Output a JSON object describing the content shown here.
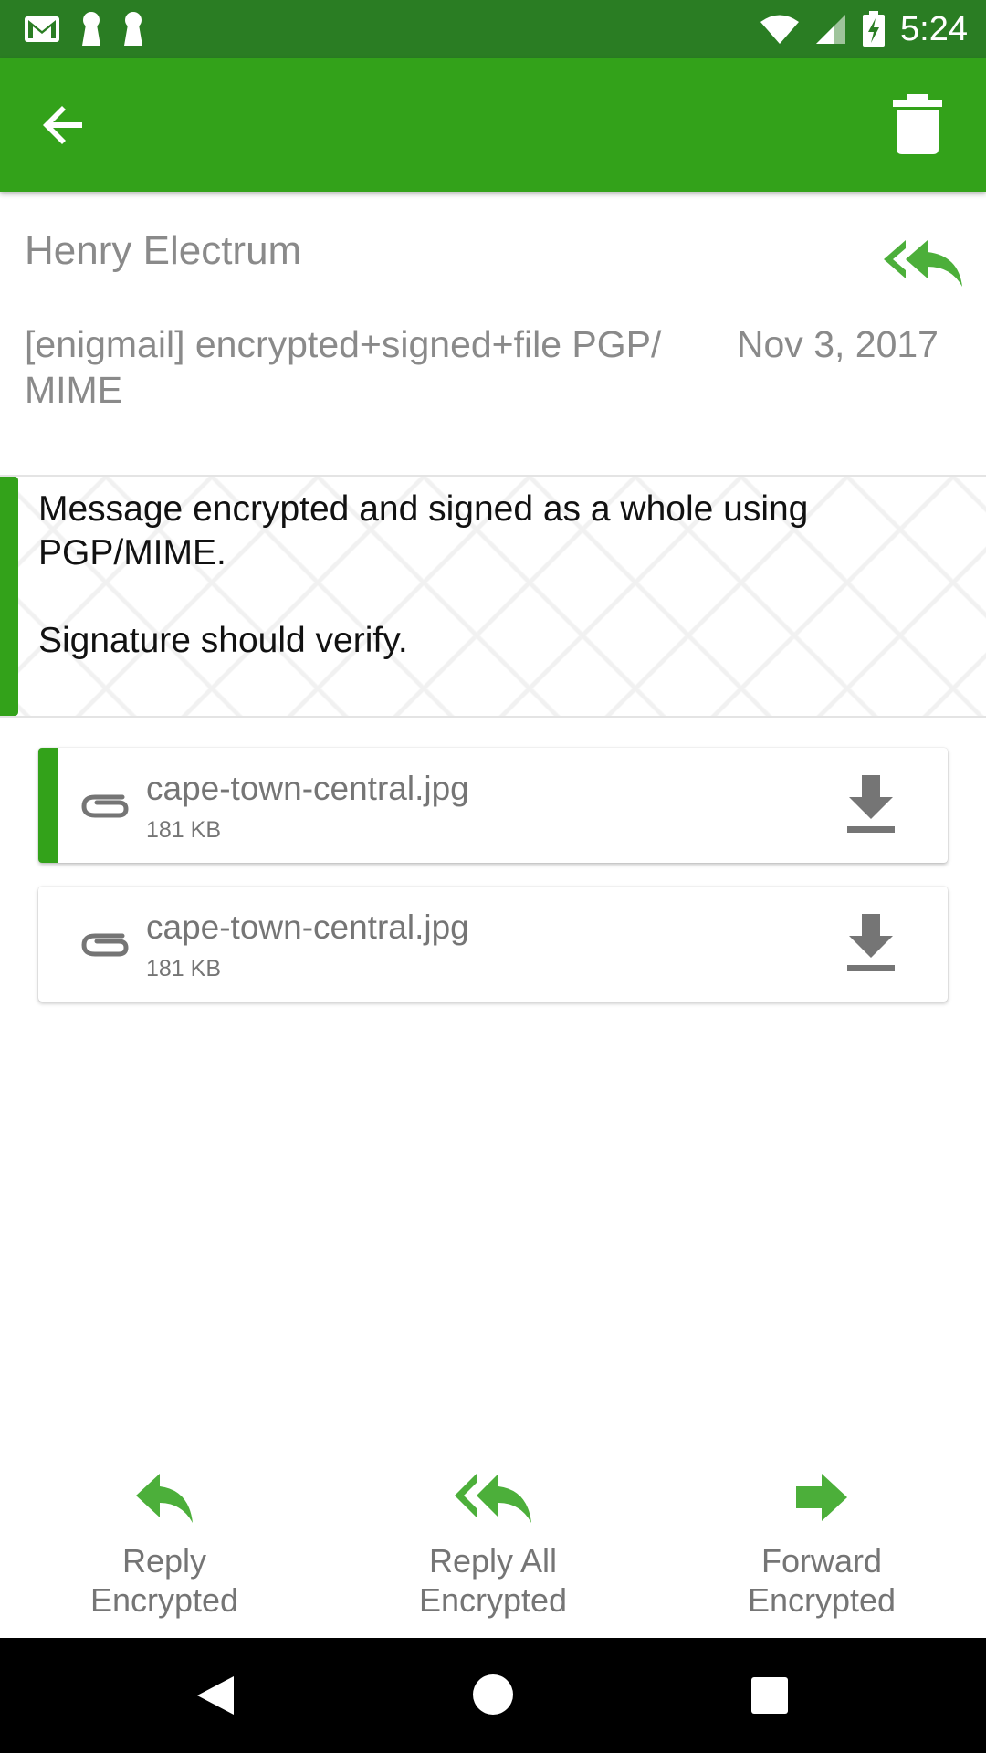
{
  "status_bar": {
    "time": "5:24",
    "icons": [
      "gmail-icon",
      "keyhole-icon",
      "keyhole-icon",
      "wifi-icon",
      "cell-signal-icon",
      "battery-charging-icon"
    ]
  },
  "app_bar": {
    "back_icon": "arrow-back-icon",
    "delete_icon": "trash-icon",
    "color": "#33a21a"
  },
  "message": {
    "sender": "Henry Electrum",
    "subject": "[enigmail] encrypted+signed+file PGP/\nMIME",
    "date": "Nov 3, 2017",
    "body": "Message encrypted and signed as a whole using PGP/MIME.\n\nSignature should verify."
  },
  "attachments": [
    {
      "name": "cape-town-central.jpg",
      "size": "181 KB",
      "highlighted": true
    },
    {
      "name": "cape-town-central.jpg",
      "size": "181 KB",
      "highlighted": false
    }
  ],
  "actions": {
    "reply": "Reply\nEncrypted",
    "reply_all": "Reply All\nEncrypted",
    "forward": "Forward\nEncrypted"
  },
  "colors": {
    "status_bar": "#2a7d23",
    "accent": "#33a21a",
    "icon_green": "#4caf3a",
    "secondary_text": "#8a8a8a"
  }
}
